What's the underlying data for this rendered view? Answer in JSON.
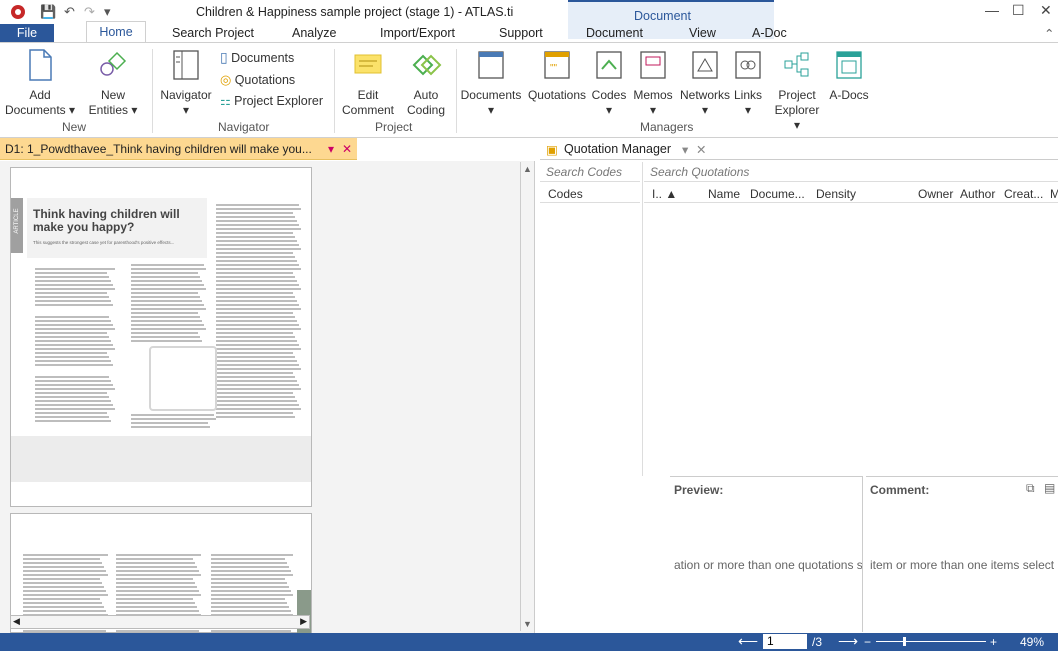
{
  "window": {
    "title": "Children & Happiness sample project (stage 1) - ATLAS.ti",
    "context_header": "Document",
    "minimize": "—",
    "maximize": "☐",
    "close": "✕",
    "collapse_ribbon": "⌃"
  },
  "tabs": [
    "File",
    "Home",
    "Search Project",
    "Analyze",
    "Import/Export",
    "Support",
    "Document",
    "View",
    "A-Doc"
  ],
  "ribbon": {
    "add_documents": "Add\nDocuments ▾",
    "new_entities": "New\nEntities ▾",
    "group_new": "New",
    "navigator": "Navigator\n▾",
    "documents": "Documents",
    "quotations": "Quotations",
    "project_explorer": "Project Explorer",
    "group_navigator": "Navigator",
    "edit_comment": "Edit\nComment",
    "auto_coding": "Auto\nCoding",
    "group_project": "Project",
    "mgr_documents": "Documents\n▾",
    "mgr_quotations": "Quotations",
    "mgr_codes": "Codes\n▾",
    "mgr_memos": "Memos\n▾",
    "mgr_networks": "Networks\n▾",
    "mgr_links": "Links\n▾",
    "mgr_project_explorer": "Project\nExplorer ▾",
    "mgr_adocs": "A-Docs",
    "group_managers": "Managers"
  },
  "doc_tab": {
    "label": "D1: 1_Powdthavee_Think having children will make you...",
    "dropdown": "▾",
    "close": "✕"
  },
  "article": {
    "side_label": "ARTICLE",
    "headline": "Think having children will make you happy?",
    "standfirst": "This suggests the strongest case yet for parenthood's positive effects..."
  },
  "quotation_manager": {
    "tab_label": "Quotation Manager",
    "tab_dropdown": "▾",
    "tab_close": "✕",
    "search_codes_placeholder": "Search Codes",
    "search_quotations_placeholder": "Search Quotations",
    "codes_header": "Codes",
    "columns": [
      "I.. ▲",
      "Name",
      "Docume...",
      "Density",
      "Owner",
      "Author",
      "Creat...",
      "M"
    ],
    "preview_label": "Preview:",
    "comment_label": "Comment:",
    "preview_hint": "ation or more than one quotations s",
    "comment_hint": "item or more than one items select"
  },
  "statusbar": {
    "page_input": "1",
    "page_total": "/3",
    "zoom": "49%"
  },
  "colors": {
    "accent": "#2b579a",
    "doc_tab": "#fdd891",
    "ribbon_icon_green": "#4caf50",
    "ribbon_icon_teal": "#2aa198"
  }
}
